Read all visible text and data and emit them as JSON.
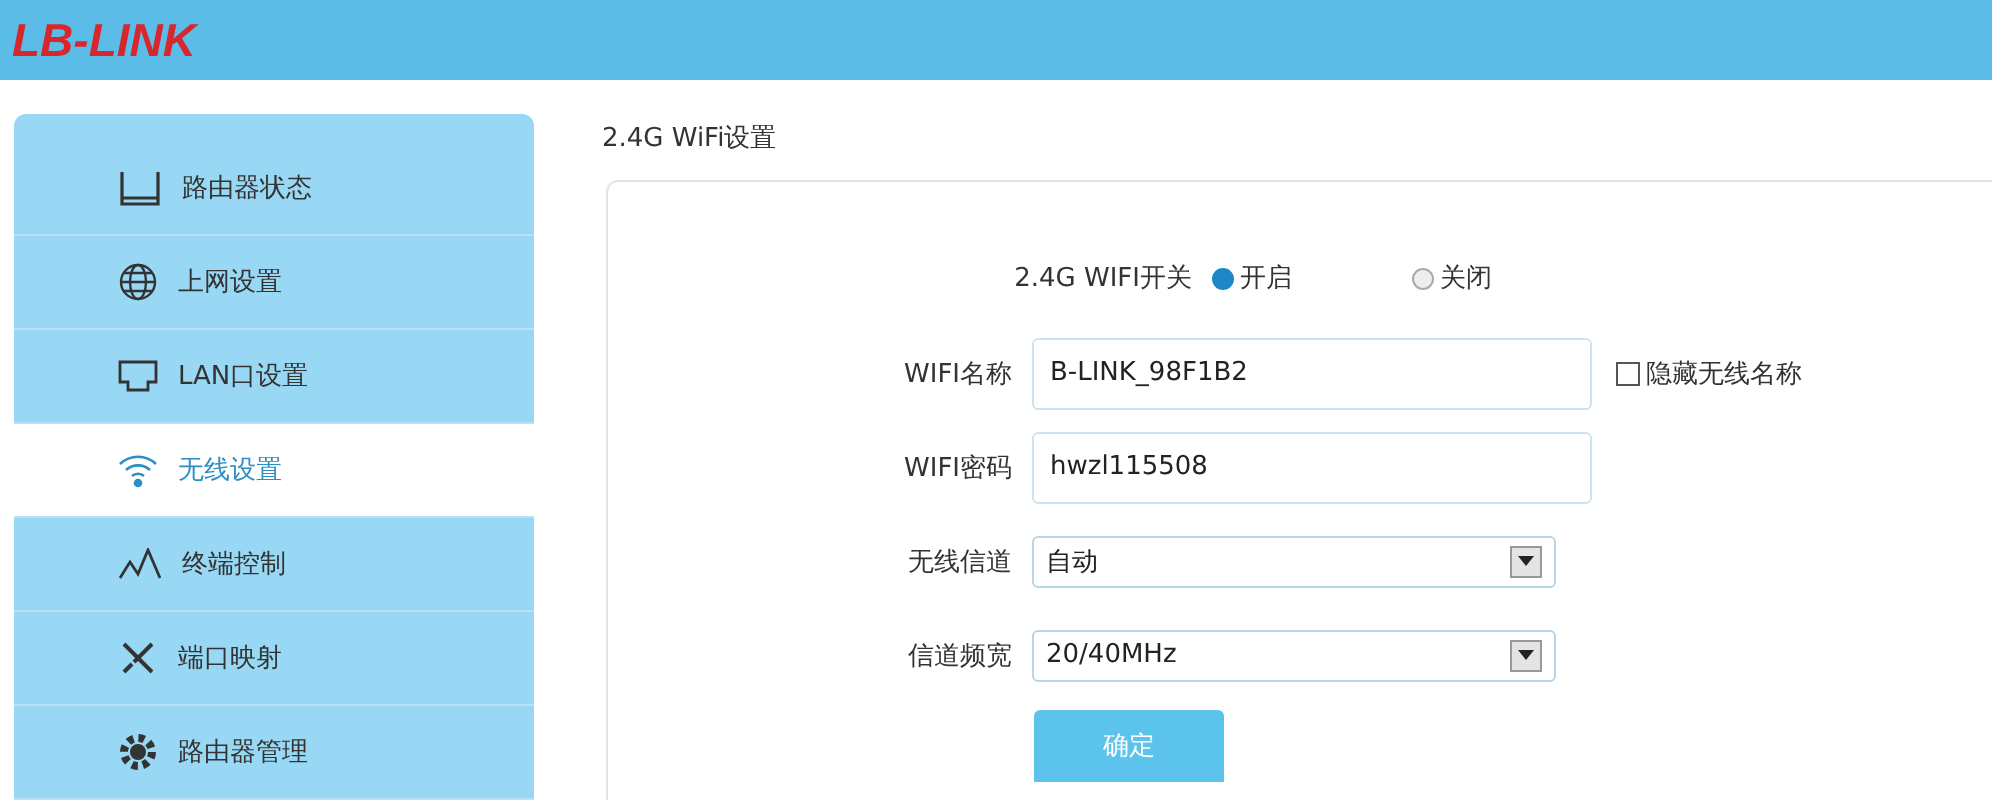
{
  "header": {
    "logo": "LB-LINK"
  },
  "sidebar": {
    "items": [
      {
        "label": "路由器状态",
        "kind": "router",
        "selected": false
      },
      {
        "label": "上网设置",
        "kind": "globe",
        "selected": false
      },
      {
        "label": "LAN口设置",
        "kind": "port",
        "selected": false
      },
      {
        "label": "无线设置",
        "kind": "wifi",
        "selected": true
      },
      {
        "label": "终端控制",
        "kind": "graph",
        "selected": false
      },
      {
        "label": "端口映射",
        "kind": "tools",
        "selected": false
      },
      {
        "label": "路由器管理",
        "kind": "gear",
        "selected": false
      }
    ]
  },
  "content": {
    "title": "2.4G WiFi设置",
    "switch": {
      "label": "2.4G WIFI开关",
      "options": [
        {
          "label": "开启",
          "selected": true
        },
        {
          "label": "关闭",
          "selected": false
        }
      ]
    },
    "fields": [
      {
        "kind": "text",
        "label": "WIFI名称",
        "value": "B-LINK_98F1B2",
        "checkbox": {
          "label": "隐藏无线名称",
          "checked": false
        }
      },
      {
        "kind": "text",
        "label": "WIFI密码",
        "value": "hwzl115508"
      },
      {
        "kind": "select",
        "label": "无线信道",
        "value": "自动"
      },
      {
        "kind": "select",
        "label": "信道频宽",
        "value": "20/40MHz"
      }
    ],
    "submit": "确定"
  }
}
